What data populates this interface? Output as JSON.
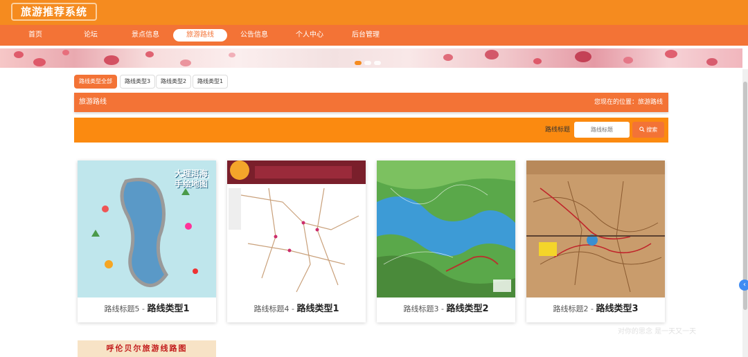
{
  "app": {
    "title": "旅游推荐系统"
  },
  "nav": {
    "items": [
      {
        "label": "首页"
      },
      {
        "label": "论坛"
      },
      {
        "label": "景点信息"
      },
      {
        "label": "旅游路线",
        "active": true
      },
      {
        "label": "公告信息"
      },
      {
        "label": "个人中心"
      },
      {
        "label": "后台管理"
      }
    ]
  },
  "filters": {
    "chips": [
      {
        "label": "路线类型全部",
        "active": true
      },
      {
        "label": "路线类型3"
      },
      {
        "label": "路线类型2"
      },
      {
        "label": "路线类型1"
      }
    ]
  },
  "section": {
    "title": "旅游路线",
    "breadcrumb": "您现在的位置：旅游路线"
  },
  "search": {
    "label": "路线标题",
    "placeholder": "路线标题",
    "button": "搜索"
  },
  "cards": [
    {
      "title": "路线标题5",
      "separator": " - ",
      "type": "路线类型1",
      "map_text": "大理洱海 手绘地图"
    },
    {
      "title": "路线标题4",
      "separator": " - ",
      "type": "路线类型1"
    },
    {
      "title": "路线标题3",
      "separator": " - ",
      "type": "路线类型2"
    },
    {
      "title": "路线标题2",
      "separator": " - ",
      "type": "路线类型3"
    }
  ],
  "partial_card": {
    "title": "呼伦贝尔旅游线路图"
  },
  "watermark": "对你的思念 是一天又一天",
  "colors": {
    "header": "#f58b1f",
    "nav": "#f37336",
    "accent": "#fb8a10"
  }
}
